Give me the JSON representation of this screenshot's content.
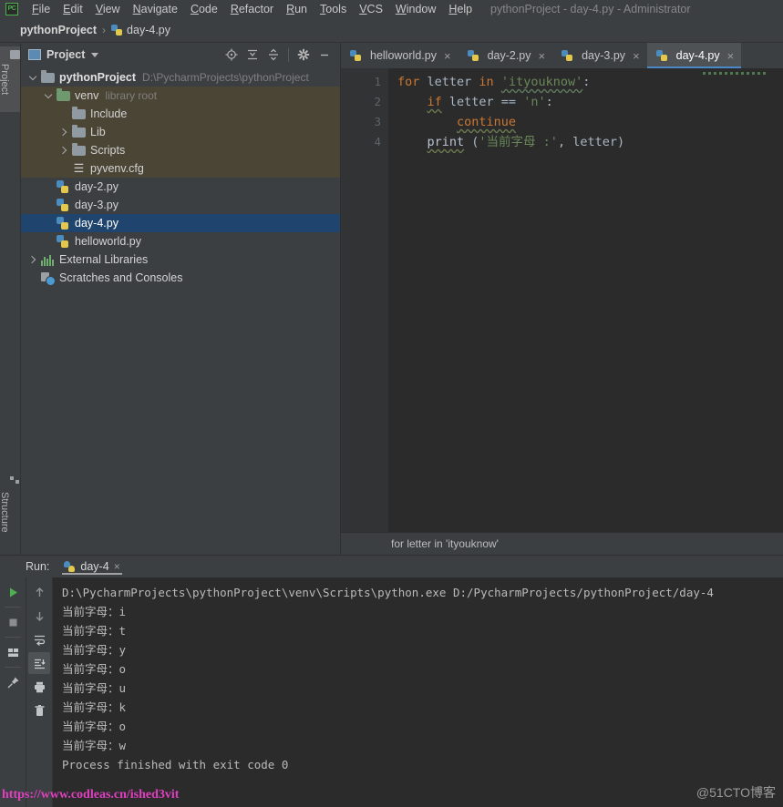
{
  "window": {
    "title": "pythonProject - day-4.py - Administrator",
    "app_icon": "pycharm-icon"
  },
  "menu": {
    "items": [
      "File",
      "Edit",
      "View",
      "Navigate",
      "Code",
      "Refactor",
      "Run",
      "Tools",
      "VCS",
      "Window",
      "Help"
    ]
  },
  "breadcrumb": {
    "project": "pythonProject",
    "separator": "›",
    "file": "day-4.py"
  },
  "left_tool_strip": {
    "top_tab": "Project",
    "bottom_tab": "Structure"
  },
  "project_panel": {
    "title": "Project",
    "tools": [
      {
        "name": "locate-icon",
        "label": "Select Opened File"
      },
      {
        "name": "expand-all-icon",
        "label": "Expand All"
      },
      {
        "name": "collapse-all-icon",
        "label": "Collapse All"
      },
      {
        "name": "settings-gear-icon",
        "label": "Settings"
      },
      {
        "name": "minimize-icon",
        "label": "Hide"
      }
    ],
    "tree": [
      {
        "label": "pythonProject",
        "path": "D:\\PycharmProjects\\pythonProject",
        "icon": "folder",
        "indent": 0,
        "arrow": "open",
        "bold": true,
        "state": "normal"
      },
      {
        "label": "venv",
        "path": "library root",
        "icon": "folder-green",
        "indent": 1,
        "arrow": "open",
        "bold": false,
        "state": "olive"
      },
      {
        "label": "Include",
        "path": "",
        "icon": "folder",
        "indent": 2,
        "arrow": "none",
        "bold": false,
        "state": "olive"
      },
      {
        "label": "Lib",
        "path": "",
        "icon": "folder",
        "indent": 2,
        "arrow": "closed",
        "bold": false,
        "state": "olive"
      },
      {
        "label": "Scripts",
        "path": "",
        "icon": "folder",
        "indent": 2,
        "arrow": "closed",
        "bold": false,
        "state": "olive"
      },
      {
        "label": "pyvenv.cfg",
        "path": "",
        "icon": "cfg",
        "indent": 2,
        "arrow": "none",
        "bold": false,
        "state": "olive"
      },
      {
        "label": "day-2.py",
        "path": "",
        "icon": "python",
        "indent": 1,
        "arrow": "none",
        "bold": false,
        "state": "normal"
      },
      {
        "label": "day-3.py",
        "path": "",
        "icon": "python",
        "indent": 1,
        "arrow": "none",
        "bold": false,
        "state": "normal"
      },
      {
        "label": "day-4.py",
        "path": "",
        "icon": "python",
        "indent": 1,
        "arrow": "none",
        "bold": false,
        "state": "selected"
      },
      {
        "label": "helloworld.py",
        "path": "",
        "icon": "python",
        "indent": 1,
        "arrow": "none",
        "bold": false,
        "state": "normal"
      },
      {
        "label": "External Libraries",
        "path": "",
        "icon": "library",
        "indent": 0,
        "arrow": "closed",
        "bold": false,
        "state": "normal"
      },
      {
        "label": "Scratches and Consoles",
        "path": "",
        "icon": "scratch",
        "indent": 0,
        "arrow": "none",
        "bold": false,
        "state": "normal"
      }
    ]
  },
  "editor": {
    "tabs": [
      {
        "label": "helloworld.py",
        "active": false,
        "close": "×"
      },
      {
        "label": "day-2.py",
        "active": false,
        "close": "×"
      },
      {
        "label": "day-3.py",
        "active": false,
        "close": "×"
      },
      {
        "label": "day-4.py",
        "active": true,
        "close": "×"
      }
    ],
    "line_numbers": [
      "1",
      "2",
      "3",
      "4"
    ],
    "code_lines": [
      {
        "n": 1,
        "tokens": [
          {
            "t": "for",
            "c": "k"
          },
          {
            "t": " letter ",
            "c": "pl"
          },
          {
            "t": "in",
            "c": "k"
          },
          {
            "t": " ",
            "c": "pl"
          },
          {
            "t": "'ityouknow'",
            "c": "s-wavy"
          },
          {
            "t": ":",
            "c": "pl"
          }
        ]
      },
      {
        "n": 2,
        "tokens": [
          {
            "t": "    ",
            "c": "pl"
          },
          {
            "t": "if",
            "c": "k-wavy"
          },
          {
            "t": " letter == ",
            "c": "pl"
          },
          {
            "t": "'n'",
            "c": "s"
          },
          {
            "t": ":",
            "c": "pl"
          }
        ]
      },
      {
        "n": 3,
        "tokens": [
          {
            "t": "        ",
            "c": "pl"
          },
          {
            "t": "continue",
            "c": "k-wavy"
          }
        ]
      },
      {
        "n": 4,
        "tokens": [
          {
            "t": "    ",
            "c": "pl"
          },
          {
            "t": "print",
            "c": "fn-wavy"
          },
          {
            "t": " (",
            "c": "pl"
          },
          {
            "t": "'当前字母 :'",
            "c": "s"
          },
          {
            "t": ", letter)",
            "c": "pl"
          }
        ]
      }
    ],
    "status_breadcrumb": "for letter in 'ityouknow'"
  },
  "run_panel": {
    "label": "Run:",
    "tab": "day-4",
    "tab_close": "×",
    "left_tools": [
      {
        "name": "rerun-icon",
        "label": "Rerun",
        "active": false
      },
      {
        "name": "stop-icon",
        "label": "Stop",
        "active": false
      },
      {
        "name": "layout-icon",
        "label": "Layout Settings",
        "active": false
      },
      {
        "name": "pin-icon",
        "label": "Pin Tab",
        "active": false
      }
    ],
    "right_tools": [
      {
        "name": "arrow-up-icon",
        "label": "Up the Stack Trace",
        "active": false
      },
      {
        "name": "arrow-down-icon",
        "label": "Down the Stack Trace",
        "active": false
      },
      {
        "name": "soft-wrap-icon",
        "label": "Soft-Wrap",
        "active": false
      },
      {
        "name": "scroll-to-end-icon",
        "label": "Scroll to End",
        "active": true
      },
      {
        "name": "print-icon",
        "label": "Print",
        "active": false
      },
      {
        "name": "trash-icon",
        "label": "Clear All",
        "active": false
      }
    ],
    "console_lines": [
      "D:\\PycharmProjects\\pythonProject\\venv\\Scripts\\python.exe D:/PycharmProjects/pythonProject/day-4",
      "当前字母：i",
      "当前字母：t",
      "当前字母：y",
      "当前字母：o",
      "当前字母：u",
      "当前字母：k",
      "当前字母：o",
      "当前字母：w",
      "Process finished with exit code 0"
    ]
  },
  "watermarks": {
    "url": "https://www.codleas.cn/ished3vit",
    "site": "@51CTO博客"
  },
  "colors": {
    "bg_panel": "#3c3f41",
    "bg_editor": "#2b2b2b",
    "selection": "#1f456e",
    "olive_highlight": "#4b4535",
    "keyword": "#cc7832",
    "string": "#6a8759",
    "function": "#b9c4d4",
    "accent_tab": "#4a88c7",
    "watermark_pink": "#e040c0"
  }
}
